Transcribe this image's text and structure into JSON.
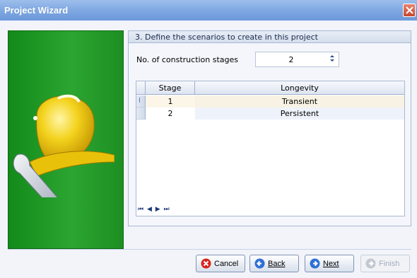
{
  "window": {
    "title": "Project Wizard"
  },
  "step": {
    "title": "3. Define the scenarios to create in this project"
  },
  "stages": {
    "label": "No. of construction stages",
    "value": "2"
  },
  "grid": {
    "columns": [
      "Stage",
      "Longevity"
    ],
    "rows": [
      {
        "stage": "1",
        "longevity": "Transient"
      },
      {
        "stage": "2",
        "longevity": "Persistent"
      }
    ],
    "nav_label": "⏮ ◀ ▶ ⏭"
  },
  "buttons": {
    "cancel": "Cancel",
    "back": "Back",
    "next": "Next",
    "finish": "Finish"
  },
  "colors": {
    "sidebar": "#2ca531",
    "titlebar": "#7fa8e2",
    "selected_row": "#f7f2e3"
  },
  "icons": {
    "close": "close-icon",
    "helmet": "hard-hat-wrench-icon",
    "cancel": "cancel-icon",
    "back": "back-arrow-icon",
    "next": "next-arrow-icon",
    "finish": "finish-icon"
  }
}
